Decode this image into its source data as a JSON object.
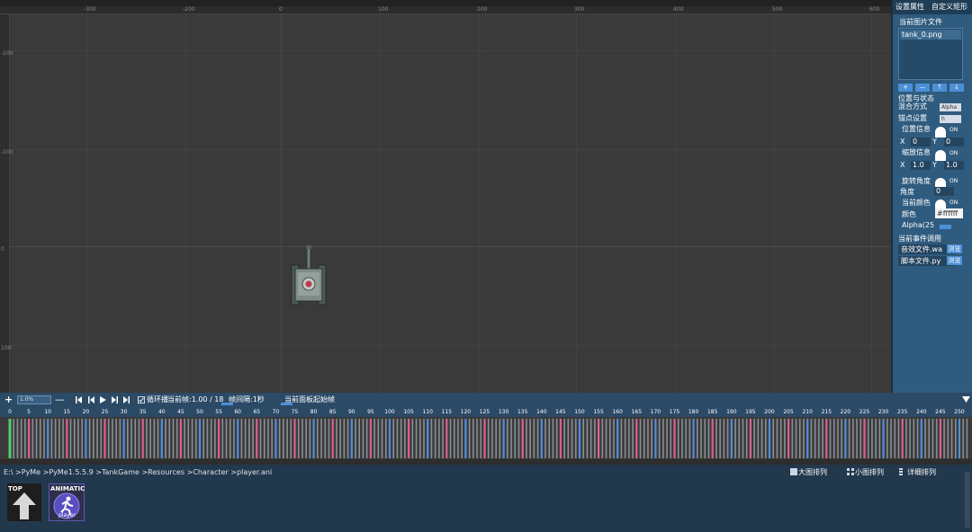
{
  "canvas": {
    "ruler_top": [
      "-300",
      "-200",
      "-100",
      "0",
      "100",
      "200",
      "300",
      "400",
      "500",
      "600"
    ],
    "ruler_left": [
      "-200",
      "-100",
      "0",
      "100"
    ]
  },
  "right_panel": {
    "tabs": [
      "设置属性",
      "自定义矩形"
    ],
    "image_file_label": "当前图片文件",
    "files": [
      "tank_0.png"
    ],
    "list_buttons": [
      "+",
      "—",
      "↑",
      "↓"
    ],
    "pos_state_label": "位置与状态",
    "blend_label": "混合方式",
    "blend_value": "Alpha",
    "anchor_label": "锚点设置",
    "anchor_value": "h",
    "position_info_label": "位置信息",
    "toggle_text": "ON",
    "x_label": "X",
    "y_label": "Y",
    "pos_x": "0",
    "pos_y": "0",
    "scale_info_label": "缩放信息",
    "scale_x": "1.0",
    "scale_y": "1.0",
    "rotation_label": "旋转角度",
    "angle_label": "角度",
    "angle_value": "0",
    "current_color_label": "当前颜色",
    "color_label": "颜色",
    "color_value": "#ffffff",
    "alpha_label": "Alpha(25",
    "events_label": "当前事件调用",
    "sound_file_label": "音效文件.wa",
    "script_file_label": "脚本文件.py",
    "browse_label": "浏览"
  },
  "toolbar": {
    "add_icon": "+",
    "speed_value": "1.0%",
    "remove_icon": "—",
    "loop_label": "循环播",
    "current_frame": "当前帧:1.00 / 18",
    "frame_interval": "帧间隔:1秒",
    "panel_start_frame": "当前面板起始帧"
  },
  "timeline": {
    "numbers": [
      "0",
      "5",
      "10",
      "15",
      "20",
      "25",
      "30",
      "35",
      "40",
      "45",
      "50",
      "55",
      "60",
      "65",
      "70",
      "75",
      "80",
      "85",
      "90",
      "95",
      "100",
      "105",
      "110",
      "115",
      "120",
      "125",
      "130",
      "135",
      "140",
      "145",
      "150",
      "155",
      "160",
      "165",
      "170",
      "175",
      "180",
      "185",
      "190",
      "195",
      "200",
      "205",
      "210",
      "215",
      "220",
      "225",
      "230",
      "235",
      "240",
      "245",
      "250"
    ],
    "accent_colors": {
      "blue": "#4f8fe0",
      "pink": "#e0608a",
      "green": "#4ed06a",
      "grey": "#8a8f96"
    }
  },
  "browser": {
    "path": "E:\\ >PyMe >PyMe1.5.5.9 >TankGame >Resources >Character >player.ani",
    "view_large": "大图排列",
    "view_small": "小图排列",
    "view_detail": "详细排列",
    "top_label": "TOP",
    "anim_label": "ANIMATIC",
    "anim_sub": "player"
  }
}
